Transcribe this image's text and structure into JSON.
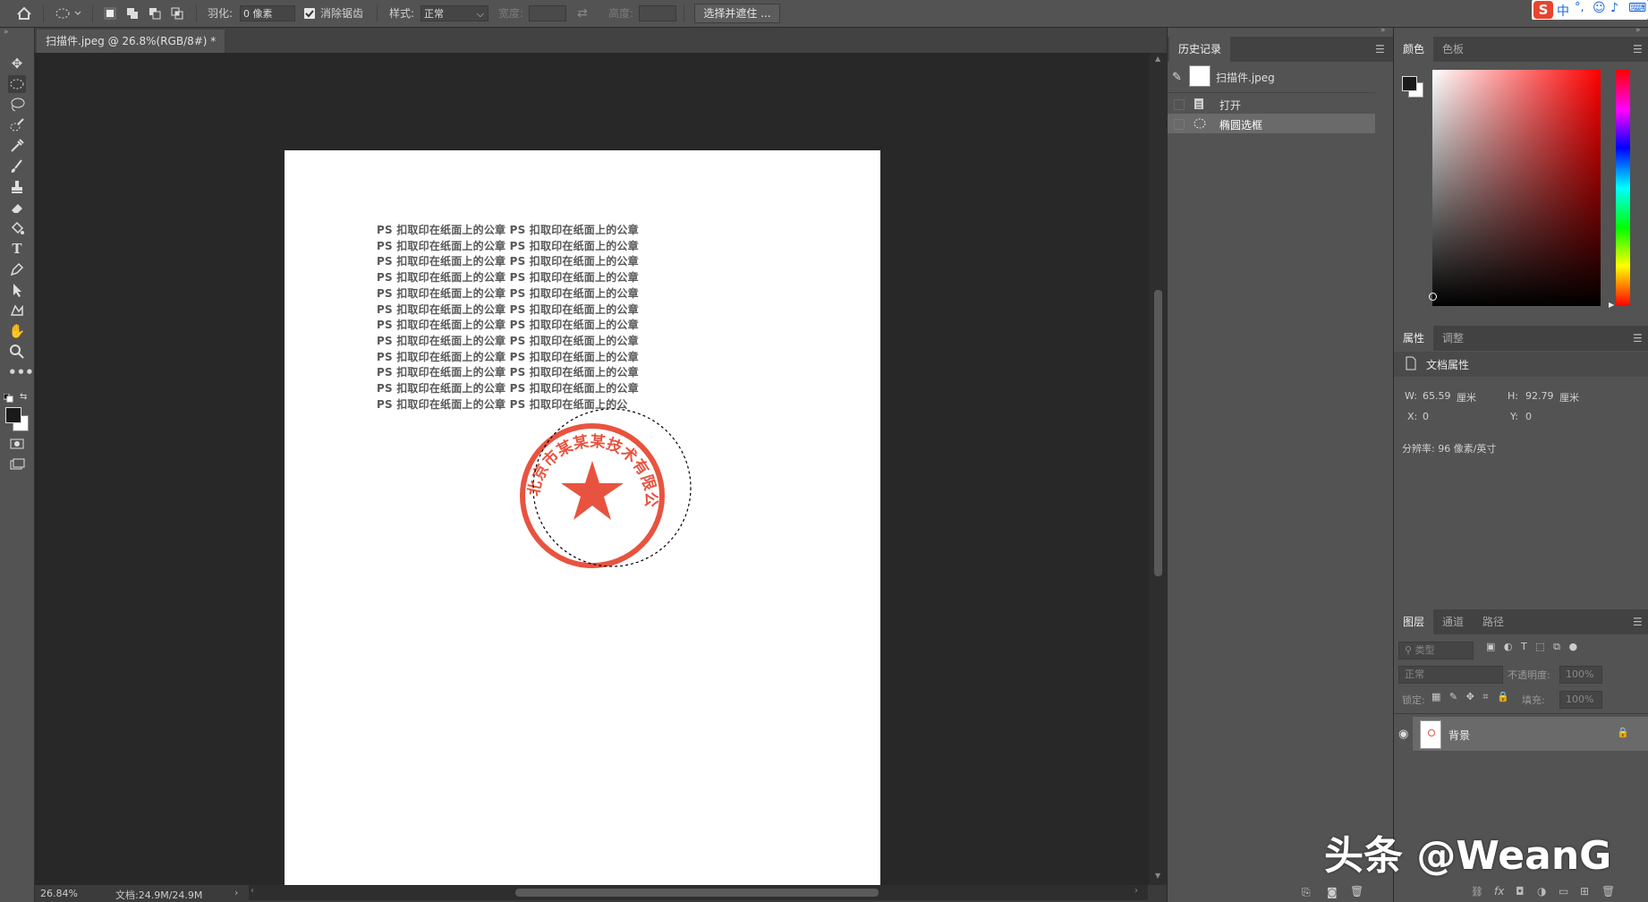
{
  "options_bar": {
    "feather_label": "羽化:",
    "feather_value": "0 像素",
    "antialias_label": "消除锯齿",
    "style_label": "样式:",
    "style_value": "正常",
    "width_label": "宽度:",
    "height_label": "高度:",
    "select_mask_button": "选择并遮住 ..."
  },
  "ime": {
    "text": "中"
  },
  "document_tab": {
    "title": "扫描件.jpeg @ 26.8%(RGB/8#) *",
    "close": "×"
  },
  "document": {
    "lines": [
      "PS 扣取印在纸面上的公章 PS 扣取印在纸面上的公章",
      "PS 扣取印在纸面上的公章 PS 扣取印在纸面上的公章",
      "PS 扣取印在纸面上的公章 PS 扣取印在纸面上的公章",
      "PS 扣取印在纸面上的公章 PS 扣取印在纸面上的公章",
      "PS 扣取印在纸面上的公章 PS 扣取印在纸面上的公章",
      "PS 扣取印在纸面上的公章 PS 扣取印在纸面上的公章",
      "PS 扣取印在纸面上的公章 PS 扣取印在纸面上的公章",
      "PS 扣取印在纸面上的公章 PS 扣取印在纸面上的公章",
      "PS 扣取印在纸面上的公章 PS 扣取印在纸面上的公章",
      "PS 扣取印在纸面上的公章 PS 扣取印在纸面上的公章",
      "PS 扣取印在纸面上的公章 PS 扣取印在纸面上的公章",
      "PS 扣取印在纸面上的公章 PS 扣取印在纸面上的公"
    ],
    "stamp_text": "北京市某某某技术有限公司",
    "stamp_color": "#e8533f"
  },
  "status": {
    "zoom": "26.84%",
    "doc_size": "文档:24.9M/24.9M"
  },
  "history": {
    "tab": "历史记录",
    "snapshot": "扫描件.jpeg",
    "items": [
      {
        "label": "打开",
        "icon": "document-icon"
      },
      {
        "label": "椭圆选框",
        "icon": "ellipse-marquee-icon"
      }
    ]
  },
  "color_panel": {
    "tabs": [
      "颜色",
      "色板"
    ],
    "foreground": "#1a1a1a",
    "background": "#ffffff",
    "hue_color": "#ff0000"
  },
  "properties": {
    "tabs": [
      "属性",
      "调整"
    ],
    "heading": "文档属性",
    "w_label": "W:",
    "w_value": "65.59",
    "w_unit": "厘米",
    "h_label": "H:",
    "h_value": "92.79",
    "h_unit": "厘米",
    "x_label": "X:",
    "x_value": "0",
    "y_label": "Y:",
    "y_value": "0",
    "resolution": "分辨率: 96 像素/英寸"
  },
  "layers": {
    "tabs": [
      "图层",
      "通道",
      "路径"
    ],
    "filter_placeholder": "类型",
    "blend_mode": "正常",
    "opacity_label": "不透明度:",
    "opacity_value": "100%",
    "lock_label": "锁定:",
    "fill_label": "填充:",
    "fill_value": "100%",
    "layer_name": "背景"
  },
  "watermark": "头条 @WeanG"
}
